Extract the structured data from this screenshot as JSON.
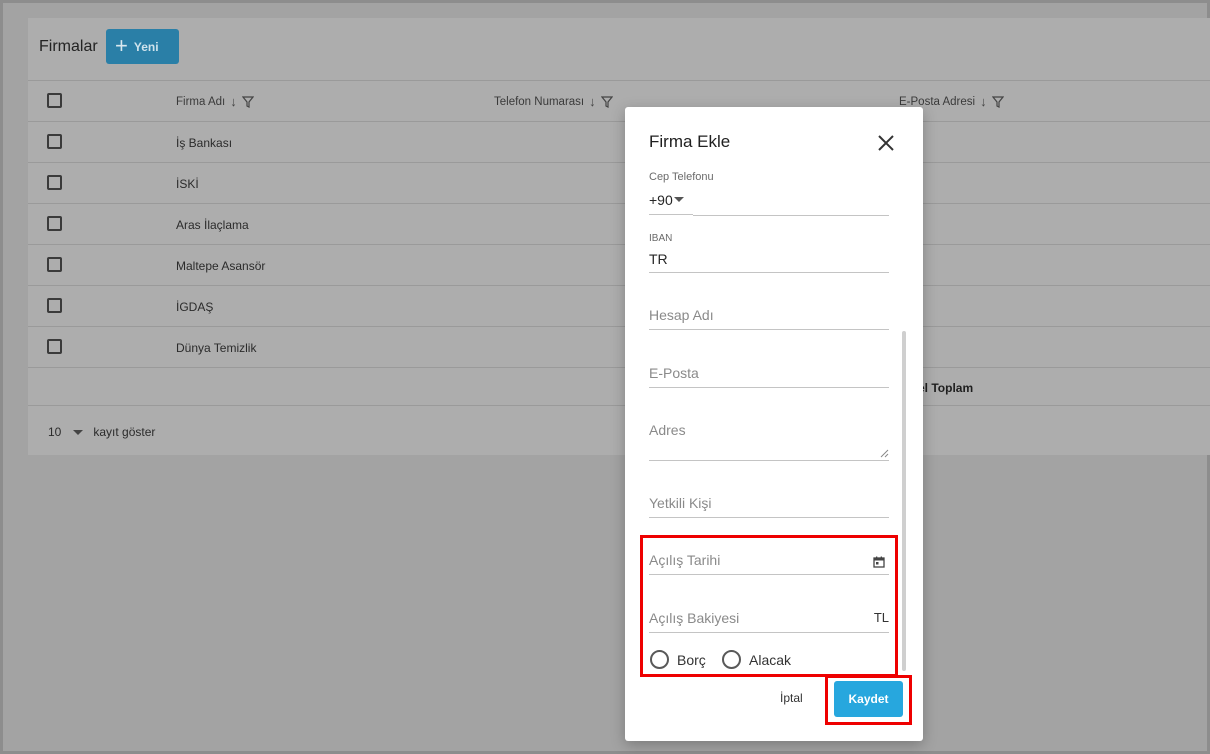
{
  "page": {
    "title": "Firmalar",
    "new_button_label": "Yeni"
  },
  "table": {
    "columns": [
      "Firma Adı",
      "Telefon Numarası",
      "E-Posta Adresi"
    ],
    "rows": [
      "İş Bankası",
      "İSKİ",
      "Aras İlaçlama",
      "Maltepe Asansör",
      "İGDAŞ",
      "Dünya Temizlik"
    ],
    "total_label": "el Toplam",
    "page_size": "10",
    "page_size_suffix": "kayıt göster"
  },
  "dialog": {
    "title": "Firma Ekle",
    "fields": {
      "cep_telefonu": {
        "label": "Cep Telefonu",
        "country_code": "+90"
      },
      "iban": {
        "label": "IBAN",
        "value": "TR"
      },
      "hesap_adi": {
        "placeholder": "Hesap Adı"
      },
      "eposta": {
        "placeholder": "E-Posta"
      },
      "adres": {
        "placeholder": "Adres"
      },
      "yetkili_kisi": {
        "placeholder": "Yetkili Kişi"
      },
      "acilis_tarihi": {
        "placeholder": "Açılış Tarihi"
      },
      "acilis_bakiyesi": {
        "placeholder": "Açılış Bakiyesi",
        "suffix": "TL"
      }
    },
    "radio_options": [
      "Borç",
      "Alacak"
    ],
    "cancel_label": "İptal",
    "save_label": "Kaydet"
  },
  "colors": {
    "accent": "#27a7de",
    "highlight": "#ee0000",
    "overlay_bg": "#a3a3a3"
  },
  "icons": [
    "plus-icon",
    "sort-down-icon",
    "filter-icon",
    "close-icon",
    "calendar-icon",
    "caret-down-icon"
  ]
}
